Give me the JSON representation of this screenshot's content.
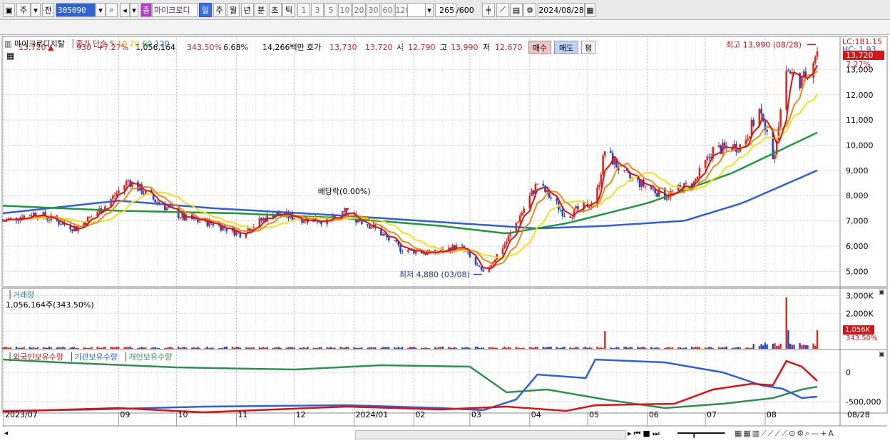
{
  "toolbar": {
    "market": "주",
    "prev_label": "전",
    "stock_code": "305090",
    "stock_name": "마이크로디",
    "stock_badge": "종",
    "periods": [
      "일",
      "주",
      "월",
      "년",
      "분",
      "초",
      "틱"
    ],
    "active_period": "일",
    "intervals": [
      "1",
      "3",
      "5",
      "10",
      "20",
      "30",
      "60",
      "120"
    ],
    "count": "265",
    "count_max": "/600",
    "date": "2024/08/28"
  },
  "quote": {
    "price": "13,720",
    "change": "930",
    "change_pct": "+7.27%",
    "volume": "1,056,164",
    "volume_ratio": "343.50%",
    "turnover": "6.68%",
    "amount": "14,266백만",
    "hoga_label": "호가",
    "ask": "13,730",
    "bid": "13,720",
    "open_label": "시",
    "open": "12,790",
    "high_label": "고",
    "high": "13,990",
    "low_label": "저",
    "low": "12,670",
    "buy_btn": "매수",
    "sell_btn": "매도",
    "eval_btn": "평"
  },
  "price_panel": {
    "name": "마이크로디지탈",
    "ma_label": "종가 단순",
    "ma_periods": [
      "5",
      "10",
      "20",
      "60",
      "120"
    ],
    "lc": "LC:181.15",
    "hc": "HC: 1.93",
    "cur_price": "13,720",
    "cur_pct": "7.27%",
    "high_note": "최고 13,990 (08/28)",
    "low_note": "최저 4,880 (03/08)",
    "dividend_note": "배당락(0.00%)",
    "y_ticks": [
      "13,000",
      "12,000",
      "11,000",
      "10,000",
      "9,000",
      "8,000",
      "7,000",
      "6,000",
      "5,000"
    ]
  },
  "volume_panel": {
    "title": "거래량",
    "value": "1,056,164주(343.50%)",
    "y_ticks": [
      "3,000K",
      "2,000K",
      "1,000K"
    ],
    "cur": "1,056K",
    "cur_pct": "343.50%"
  },
  "holding_panel": {
    "titles": [
      "외국인보유수량",
      "기관보유수량",
      "개인보유수량"
    ],
    "y_ticks": [
      "0",
      "-500,000"
    ]
  },
  "x_axis": {
    "labels": [
      "2023/07",
      "09",
      "10",
      "11",
      "12",
      "2024/01",
      "02",
      "03",
      "04",
      "05",
      "06",
      "07",
      "08"
    ],
    "end_label": "08/28"
  },
  "colors": {
    "up": "#e0261b",
    "down": "#1a46d6",
    "ma5": "#e01010",
    "ma10": "#f08a10",
    "ma20": "#f2e01a",
    "ma60": "#1f9a3a",
    "ma120": "#2f5fe0",
    "foreign": "#e01010",
    "institution": "#2f5fe0",
    "individual": "#2e8f4e"
  },
  "chart_data": {
    "type": "candlestick",
    "ma_series_names": [
      "5",
      "10",
      "20",
      "60",
      "120"
    ],
    "price_path": [
      [
        "2023-07-03",
        7000
      ],
      [
        "2023-07-20",
        7300
      ],
      [
        "2023-08-10",
        6700
      ],
      [
        "2023-08-25",
        7600
      ],
      [
        "2023-09-06",
        8600
      ],
      [
        "2023-09-20",
        7800
      ],
      [
        "2023-10-05",
        7100
      ],
      [
        "2023-10-20",
        6900
      ],
      [
        "2023-11-03",
        6500
      ],
      [
        "2023-11-20",
        7300
      ],
      [
        "2023-12-05",
        7100
      ],
      [
        "2023-12-20",
        7000
      ],
      [
        "2023-12-28",
        7300
      ],
      [
        "2024-01-10",
        6800
      ],
      [
        "2024-01-25",
        5900
      ],
      [
        "2024-02-10",
        5700
      ],
      [
        "2024-02-25",
        6000
      ],
      [
        "2024-03-08",
        4880
      ],
      [
        "2024-03-20",
        6200
      ],
      [
        "2024-04-05",
        8500
      ],
      [
        "2024-04-20",
        7200
      ],
      [
        "2024-05-05",
        7800
      ],
      [
        "2024-05-10",
        9800
      ],
      [
        "2024-05-20",
        8800
      ],
      [
        "2024-06-10",
        8000
      ],
      [
        "2024-06-25",
        8500
      ],
      [
        "2024-07-05",
        9800
      ],
      [
        "2024-07-20",
        10000
      ],
      [
        "2024-07-30",
        11500
      ],
      [
        "2024-08-05",
        9300
      ],
      [
        "2024-08-12",
        13000
      ],
      [
        "2024-08-20",
        12500
      ],
      [
        "2024-08-28",
        13720
      ]
    ],
    "ma60": [
      [
        "2023-07-03",
        7600
      ],
      [
        "2023-09-01",
        7400
      ],
      [
        "2023-11-01",
        7300
      ],
      [
        "2023-12-28",
        7100
      ],
      [
        "2024-02-15",
        6800
      ],
      [
        "2024-03-20",
        6500
      ],
      [
        "2024-04-20",
        6900
      ],
      [
        "2024-06-01",
        7700
      ],
      [
        "2024-07-15",
        8900
      ],
      [
        "2024-08-28",
        10500
      ]
    ],
    "ma120": [
      [
        "2023-07-03",
        7300
      ],
      [
        "2023-09-01",
        7800
      ],
      [
        "2023-10-20",
        7500
      ],
      [
        "2023-12-28",
        7200
      ],
      [
        "2024-02-15",
        6950
      ],
      [
        "2024-04-05",
        6700
      ],
      [
        "2024-05-10",
        6800
      ],
      [
        "2024-06-20",
        7000
      ],
      [
        "2024-07-20",
        7700
      ],
      [
        "2024-08-28",
        9000
      ]
    ],
    "ma20": [
      [
        "2023-07-03",
        7100
      ],
      [
        "2023-09-15",
        7500
      ],
      [
        "2023-11-15",
        7000
      ],
      [
        "2023-12-28",
        7100
      ],
      [
        "2024-02-15",
        5800
      ],
      [
        "2024-03-15",
        5700
      ],
      [
        "2024-04-20",
        7500
      ],
      [
        "2024-05-25",
        8400
      ],
      [
        "2024-06-25",
        8300
      ],
      [
        "2024-07-25",
        10300
      ],
      [
        "2024-08-10",
        10900
      ],
      [
        "2024-08-28",
        11700
      ]
    ],
    "volume_spikes": [
      [
        "2024-05-10",
        1000
      ],
      [
        "2024-08-12",
        2900
      ],
      [
        "2024-08-13",
        1050
      ],
      [
        "2024-08-28",
        1056
      ]
    ],
    "y_range": [
      4500,
      14200
    ],
    "volume_range": [
      0,
      3300
    ]
  }
}
